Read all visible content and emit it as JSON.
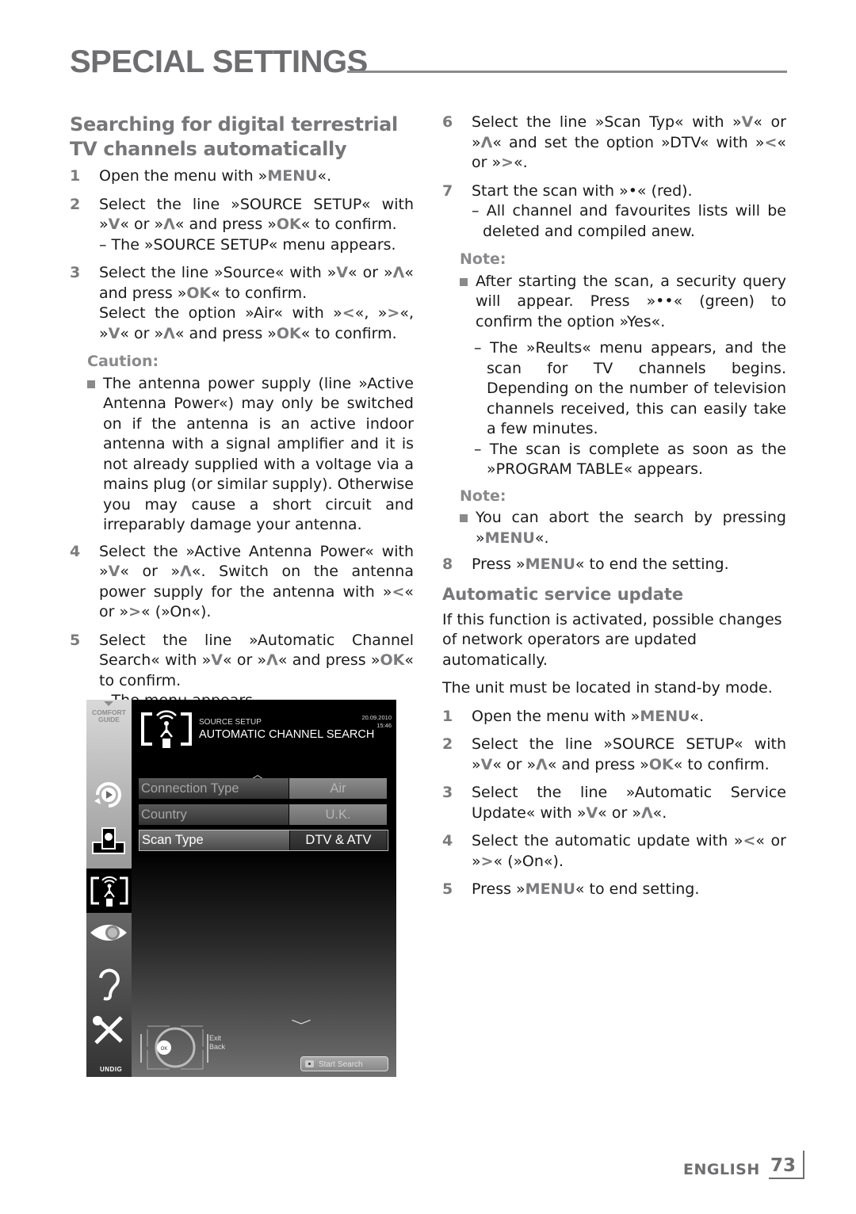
{
  "page": {
    "title": "SPECIAL SETTINGS",
    "footer_language": "ENGLISH",
    "page_number": "73"
  },
  "left_column": {
    "heading": "Searching for digital terrestrial TV channels automatically",
    "steps": [
      {
        "num": "1",
        "text": "Open the menu with »MENU«."
      },
      {
        "num": "2",
        "text": "Select the line »SOURCE SETUP« with »V« or »Λ« and press »OK« to confirm.",
        "sub": "– The »SOURCE SETUP« menu appears."
      },
      {
        "num": "3",
        "text": "Select the line »Source« with »V« or »Λ« and press »OK« to confirm.",
        "sub": "Select the option »Air« with »<«, »>«, »V« or »Λ« and press »OK« to confirm."
      }
    ],
    "caution": {
      "label": "Caution:",
      "text": "The antenna power supply (line »Active Antenna Power«) may only be switched on if the antenna is an active indoor antenna with a signal amplifier and it is not already supplied with a voltage via a mains plug (or similar supply). Otherwise you may cause a short circuit and irreparably damage your antenna."
    },
    "steps_after": [
      {
        "num": "4",
        "text": "Select the »Active Antenna Power« with »V« or »Λ«. Switch on the antenna power supply for the antenna with »<« or »>« (»On«)."
      },
      {
        "num": "5",
        "text": "Select the line »Automatic Channel Search« with »V« or »Λ« and press »OK« to confirm.",
        "sub": "– The menu appears."
      }
    ]
  },
  "tv_screen": {
    "comfort_guide": "COMFORT GUIDE",
    "menu_section": "SOURCE SETUP",
    "menu_title": "AUTOMATIC CHANNEL SEARCH",
    "date": "20.09.2010",
    "time": "15:46",
    "rows": [
      {
        "label": "Connection Type",
        "value": "Air",
        "selected": false
      },
      {
        "label": "Country",
        "value": "U.K.",
        "selected": false
      },
      {
        "label": "Scan Type",
        "value": "DTV & ATV",
        "selected": true
      }
    ],
    "remote_ok": "OK",
    "exit_label": "Exit",
    "back_label": "Back",
    "start_search_label": "Start Search",
    "brand": "UNDIG",
    "sidebar_icons": [
      "source-play-icon",
      "network-globe-icon",
      "antenna-source-icon",
      "eye-picture-icon",
      "ear-sound-icon",
      "tools-settings-icon"
    ]
  },
  "right_column": {
    "steps": [
      {
        "num": "6",
        "text": "Select the line »Scan Typ« with »V« or »Λ« and set the option »DTV« with »<« or »>«."
      },
      {
        "num": "7",
        "text": "Start the scan with »•« (red).",
        "sub": "– All channel and favourites lists will be deleted and compiled anew."
      }
    ],
    "note1": {
      "label": "Note:",
      "text": "After starting the scan, a security query will appear. Press »••« (green) to confirm the option »Yes«.",
      "dashes": [
        "– The »Reults« menu appears, and the scan for TV channels begins. Depending on the number of television channels received, this can easily take a few minutes.",
        "– The scan is complete as soon as the »PROGRAM TABLE« appears."
      ]
    },
    "note2": {
      "label": "Note:",
      "text": "You can abort the search by pressing »MENU«."
    },
    "step8": {
      "num": "8",
      "text": "Press »MENU« to end the setting."
    },
    "service_update": {
      "heading": "Automatic service update",
      "intro": "If this function is activated, possible changes of network operators are updated automatically.",
      "standby": "The unit must be located in stand-by mode.",
      "steps": [
        {
          "num": "1",
          "text": "Open the menu with »MENU«."
        },
        {
          "num": "2",
          "text": "Select the line »SOURCE SETUP« with »V« or »Λ« and press »OK« to confirm."
        },
        {
          "num": "3",
          "text": "Select the line »Automatic Service Update« with »V« or »Λ«."
        },
        {
          "num": "4",
          "text": "Select the automatic update with »<« or »>« (»On«)."
        },
        {
          "num": "5",
          "text": "Press »MENU« to end setting."
        }
      ]
    }
  }
}
